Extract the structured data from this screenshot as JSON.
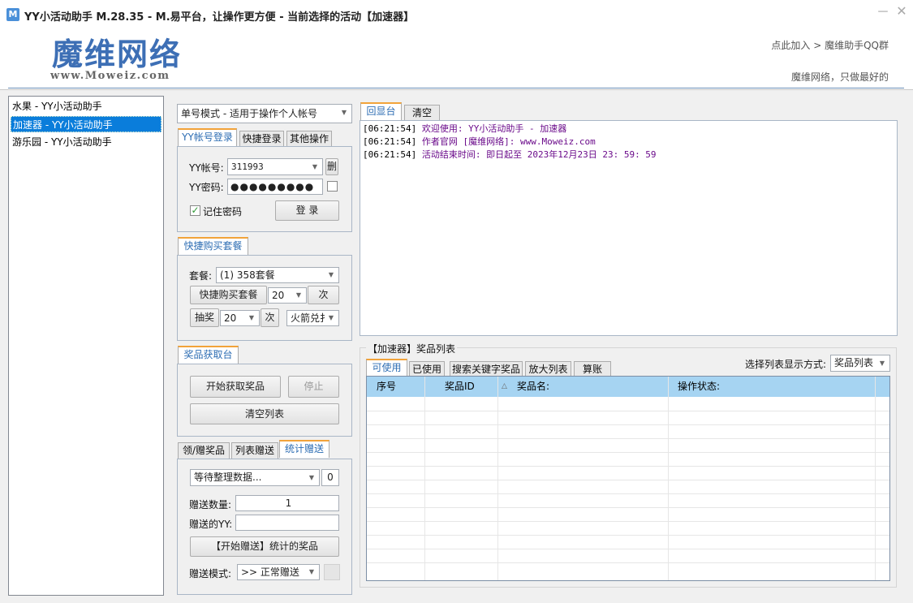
{
  "window": {
    "icon_letter": "M",
    "title": "YY小活动助手 M.28.35  -  M.易平台，让操作更方便  -  当前选择的活动【加速器】",
    "minimize": "－",
    "close": "✕"
  },
  "header": {
    "logo_main": "魔维网络",
    "logo_sub": "www.Moweiz.com",
    "link_text": "点此加入 > 魔维助手QQ群",
    "slogan": "魔维网络，只做最好的"
  },
  "activities": [
    {
      "label": "水果 - YY小活动助手",
      "selected": false
    },
    {
      "label": "加速器 - YY小活动助手",
      "selected": true
    },
    {
      "label": "游乐园 - YY小活动助手",
      "selected": false
    }
  ],
  "mode_select": {
    "value": "单号模式 - 适用于操作个人帐号"
  },
  "login_tabs": [
    "YY帐号登录",
    "快捷登录",
    "其他操作"
  ],
  "login": {
    "account_label": "YY帐号:",
    "account_value": "311993",
    "delete_label": "删",
    "password_label": "YY密码:",
    "password_value": "●●●●●●●●●",
    "remember_label": "记住密码",
    "login_button": "登 录"
  },
  "quick_buy": {
    "tab": "快捷购买套餐",
    "package_label": "套餐:",
    "package_value": "(1) 358套餐",
    "buy_button": "快捷购买套餐",
    "buy_count": "20",
    "times_unit": "次",
    "lottery_button": "抽奖",
    "lottery_count": "20",
    "lottery_unit": "次",
    "exchange_value": "火箭兑扌"
  },
  "prize_fetch": {
    "tab": "奖品获取台",
    "start_button": "开始获取奖品",
    "stop_button": "停止",
    "clear_button": "清空列表"
  },
  "gift_tabs": [
    "领/赠奖品",
    "列表赠送",
    "统计赠送"
  ],
  "gift": {
    "status_value": "等待整理数据...",
    "status_count": "0",
    "amount_label": "赠送数量:",
    "amount_value": "1",
    "target_label": "赠送的YY:",
    "target_value": "",
    "start_button": "【开始赠送】统计的奖品",
    "mode_label": "赠送模式:",
    "mode_value": ">> 正常赠送"
  },
  "log_tabs": [
    "回显台",
    "清空"
  ],
  "log_lines": [
    {
      "time": "[06:21:54]",
      "message": "欢迎使用: YY小活动助手 - 加速器"
    },
    {
      "time": "[06:21:54]",
      "message": "作者官网 [魔维网络]: www.Moweiz.com"
    },
    {
      "time": "[06:21:54]",
      "message": "活动结束时间: 即日起至 2023年12月23日 23: 59: 59"
    }
  ],
  "prize_list": {
    "title": "【加速器】奖品列表",
    "tabs": [
      "可使用",
      "已使用",
      "搜索关键字奖品",
      "放大列表",
      "算账"
    ],
    "view_label": "选择列表显示方式:",
    "view_value": "奖品列表",
    "columns": [
      "序号",
      "奖品ID",
      "奖品名:",
      "操作状态:"
    ],
    "sort_marker": "△"
  },
  "colors": {
    "accent": "#2d6db3",
    "selection": "#0a7ddb",
    "grid_header": "#a6d4f2",
    "log_message": "#6a0a8a",
    "tab_active_border": "#f2a33a"
  }
}
